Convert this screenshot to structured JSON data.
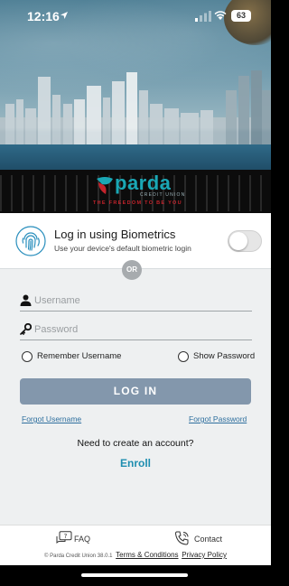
{
  "status_bar": {
    "time": "12:16",
    "battery": "63"
  },
  "brand": {
    "name": "parda",
    "subtitle": "CREDIT UNION",
    "tagline": "THE FREEDOM TO BE YOU",
    "colors": {
      "teal": "#1aa7b5",
      "red": "#c4232b"
    }
  },
  "biometrics": {
    "title": "Log in using Biometrics",
    "subtitle": "Use your device's default biometric login",
    "enabled": false
  },
  "divider": {
    "label": "OR"
  },
  "form": {
    "username": {
      "value": "",
      "placeholder": "Username"
    },
    "password": {
      "value": "",
      "placeholder": "Password"
    },
    "remember_username": "Remember Username",
    "show_password": "Show Password",
    "login_button": "LOG IN",
    "forgot_username": "Forgot Username",
    "forgot_password": "Forgot Password"
  },
  "enroll": {
    "prompt": "Need to create an account?",
    "link": "Enroll"
  },
  "footer": {
    "faq": "FAQ",
    "contact": "Contact",
    "copyright": "© Parda Credit Union 38.0.1",
    "terms": "Terms & Conditions",
    "privacy": "Privacy Policy"
  },
  "colors": {
    "login_button": "#8397ac",
    "link": "#2e6f9e",
    "enroll": "#1f8eb0",
    "or_badge": "#a7abae"
  }
}
